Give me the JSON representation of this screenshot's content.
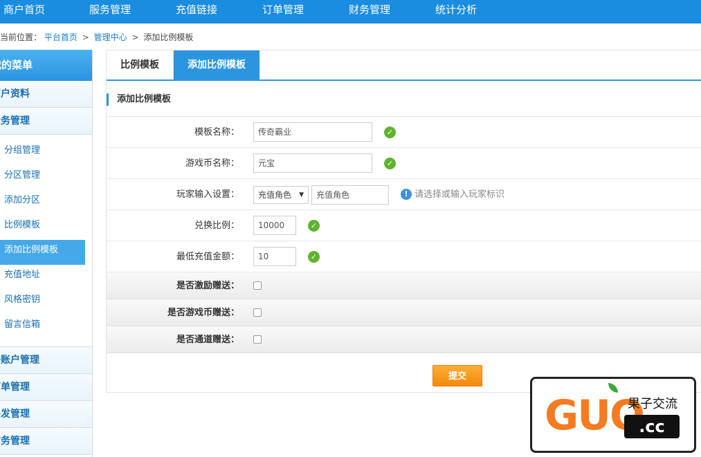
{
  "nav": {
    "items": [
      "商户首页",
      "服务管理",
      "充值链接",
      "订单管理",
      "财务管理",
      "统计分析"
    ]
  },
  "breadcrumb": {
    "prefix": "当前位置：",
    "items": [
      "平台首页",
      "管理中心",
      "添加比例模板"
    ],
    "separator": ">"
  },
  "sidebar": {
    "title": "我的菜单",
    "groups": {
      "merchant": "商户资料",
      "service": "服务管理",
      "subaccount": "子账户管理",
      "orders": "订单管理",
      "resend": "补发管理",
      "finance": "财务管理"
    },
    "service_items": [
      "分组管理",
      "分区管理",
      "添加分区",
      "比例模板",
      "添加比例模板",
      "充值地址",
      "风格密钥",
      "留言信箱"
    ]
  },
  "tabs": [
    "比例模板",
    "添加比例模板"
  ],
  "section_title": "添加比例模板",
  "form": {
    "template_name": {
      "label": "模板名称：",
      "value": "传奇霸业"
    },
    "currency_name": {
      "label": "游戏币名称：",
      "value": "元宝"
    },
    "player_input": {
      "label": "玩家输入设置：",
      "select_value": "充值角色",
      "input_value": "充值角色",
      "hint": "请选择或输入玩家标识"
    },
    "exchange_ratio": {
      "label": "兑换比例：",
      "value": "10000"
    },
    "min_amount": {
      "label": "最低充值金额：",
      "value": "10"
    },
    "bonus": {
      "label": "是否激励赠送："
    },
    "currency_bonus": {
      "label": "是否游戏币赠送："
    },
    "channel_bonus": {
      "label": "是否通道赠送："
    },
    "submit": "提交"
  },
  "watermark": {
    "brand": "GUO",
    "cn": "果子交流",
    "domain": ".cc"
  },
  "colors": {
    "primary": "#1a8de0",
    "submit": "#f38a0c",
    "success": "#5fb32f"
  }
}
